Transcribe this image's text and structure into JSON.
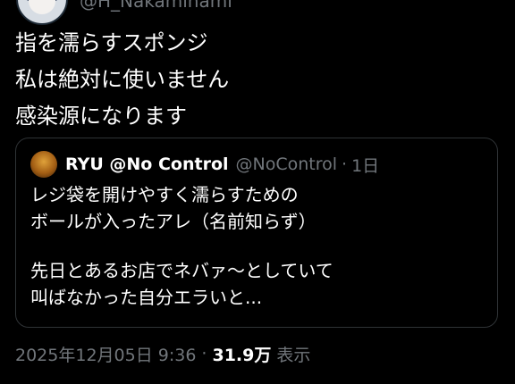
{
  "author": {
    "handle": "@H_Nakaminami"
  },
  "tweet": {
    "lines": [
      "指を濡らすスポンジ",
      "私は絶対に使いません",
      "感染源になります"
    ]
  },
  "quote": {
    "display_name": "RYU @No Control",
    "handle": "@NoControl",
    "separator": "·",
    "time": "1日",
    "paragraph1": [
      "レジ袋を開けやすく濡らすための",
      "ボールが入ったアレ（名前知らず）"
    ],
    "paragraph2": [
      "先日とあるお店でネバァ〜としていて",
      "叫ばなかった自分エラいと..."
    ]
  },
  "meta": {
    "timestamp": "2025年12月05日 9:36",
    "separator": "·",
    "views_count": "31.9万",
    "views_label": "表示"
  },
  "colors": {
    "background": "#000000",
    "text_primary": "#ffffff",
    "text_secondary": "#71767b",
    "border": "#2f3336"
  }
}
